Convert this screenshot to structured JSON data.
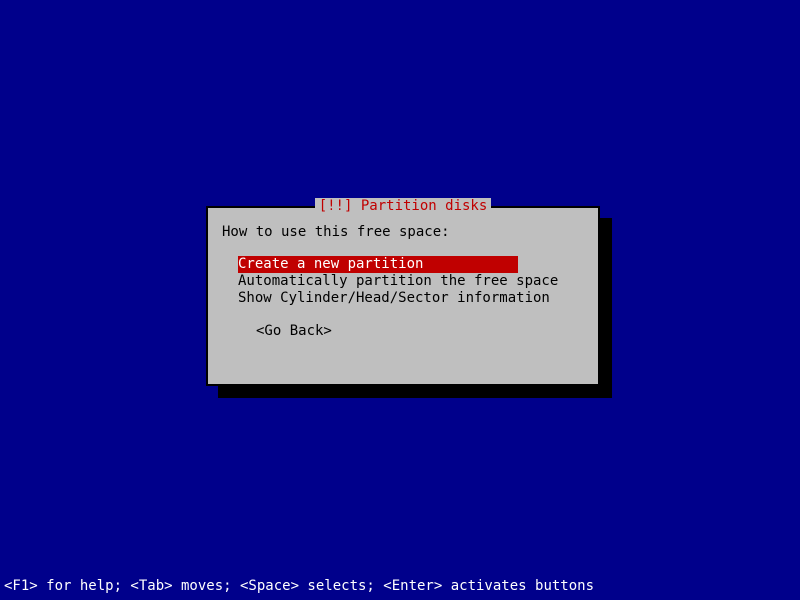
{
  "dialog": {
    "title_prefix": "[!!]",
    "title_text": "Partition disks",
    "prompt": "How to use this free space:",
    "options": [
      "Create a new partition",
      "Automatically partition the free space",
      "Show Cylinder/Head/Sector information"
    ],
    "selected_index": 0,
    "go_back_label": "<Go Back>"
  },
  "status_bar": {
    "text": "<F1> for help; <Tab> moves; <Space> selects; <Enter> activates buttons"
  }
}
